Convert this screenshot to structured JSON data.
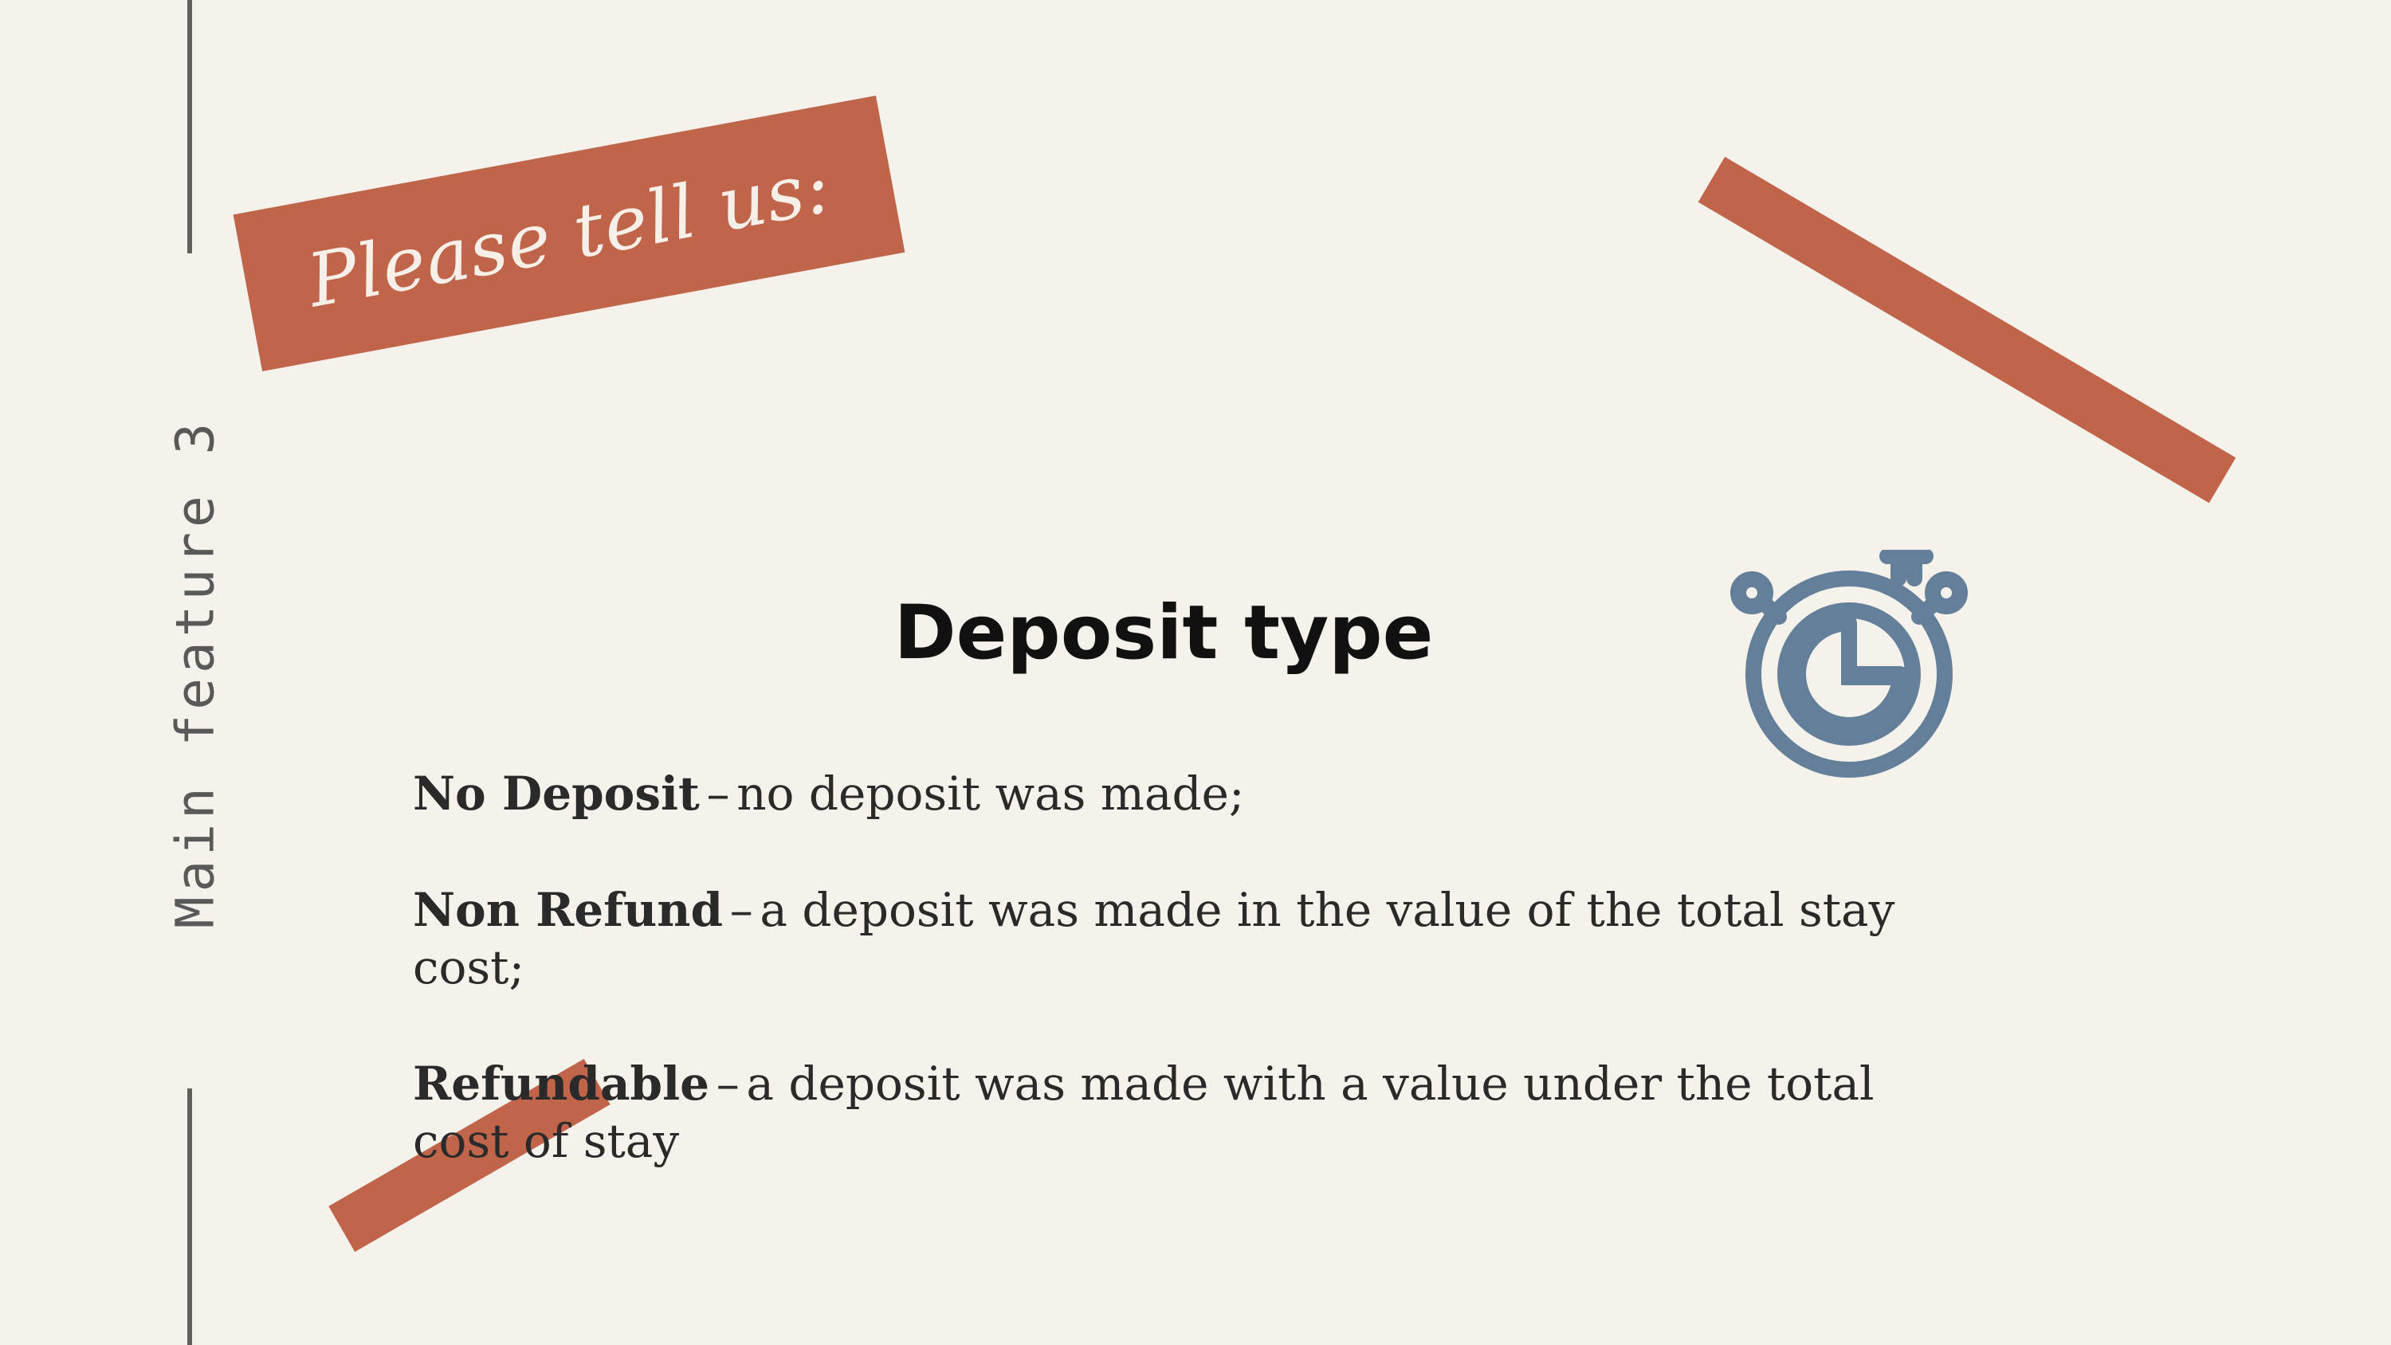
{
  "side_label": "Main feature 3",
  "banner": {
    "text": "Please tell us:"
  },
  "title": "Deposit type",
  "definitions": [
    {
      "term": "No Deposit",
      "separator": "–",
      "description": "no deposit was made;"
    },
    {
      "term": "Non Refund",
      "separator": "–",
      "description": "a deposit was made in the value of the total stay cost;"
    },
    {
      "term": "Refundable",
      "separator": "–",
      "description": "a deposit was made with a value under the total cost of stay"
    }
  ],
  "icons": {
    "timer": "stopwatch-icon"
  },
  "colors": {
    "background": "#f5f1eb",
    "accent": "#c0644a",
    "icon": "#647f99",
    "rule": "#5f5f5f",
    "text": "#2a2a2a"
  }
}
